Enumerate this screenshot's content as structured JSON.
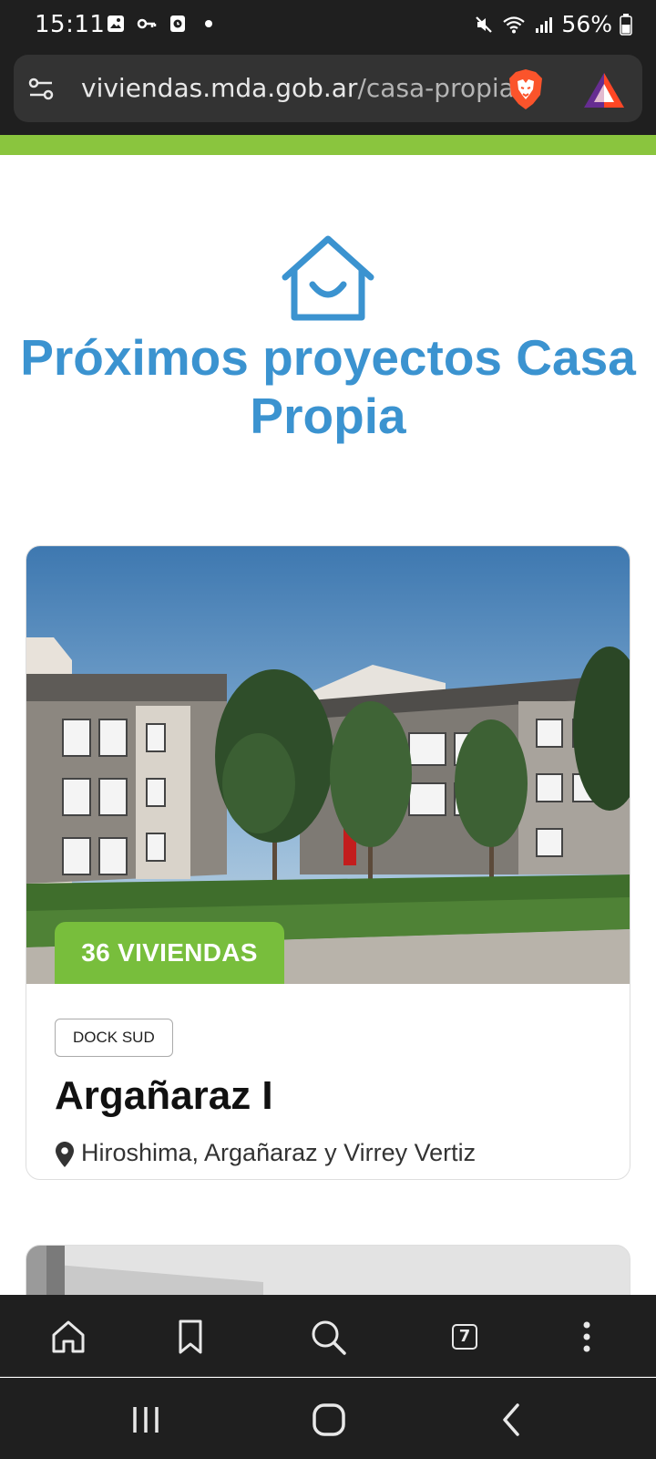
{
  "status_bar": {
    "time": "15:11",
    "battery": "56%",
    "left_icons": [
      "image-icon",
      "key-icon",
      "clock-app-icon",
      "dot-icon"
    ],
    "right_icons": [
      "mute-icon",
      "wifi-icon",
      "signal-icon",
      "battery-icon"
    ]
  },
  "url_bar": {
    "domain": "viviendas.mda.gob.ar",
    "path": "/casa-propia",
    "left_icon": "site-settings-icon",
    "right_icons": [
      "brave-shields-icon",
      "brave-rewards-icon"
    ]
  },
  "colors": {
    "accent_green": "#8ac53e",
    "badge_green": "#78be3c",
    "headline_blue": "#3b93d0"
  },
  "page": {
    "headline_regular": "Próximos proyectos ",
    "headline_bold": "Casa Propia"
  },
  "project": {
    "badge": "36 VIVIENDAS",
    "location_tag": "DOCK SUD",
    "title": "Argañaraz I",
    "address": "Hiroshima, Argañaraz y Virrey Vertiz"
  },
  "toolbar": {
    "tabs_count": "7",
    "buttons": [
      "home-icon",
      "bookmark-icon",
      "search-icon",
      "tabs-icon",
      "more-icon"
    ]
  },
  "nav_bar": {
    "buttons": [
      "recent-apps-icon",
      "home-circle-icon",
      "back-icon"
    ]
  }
}
